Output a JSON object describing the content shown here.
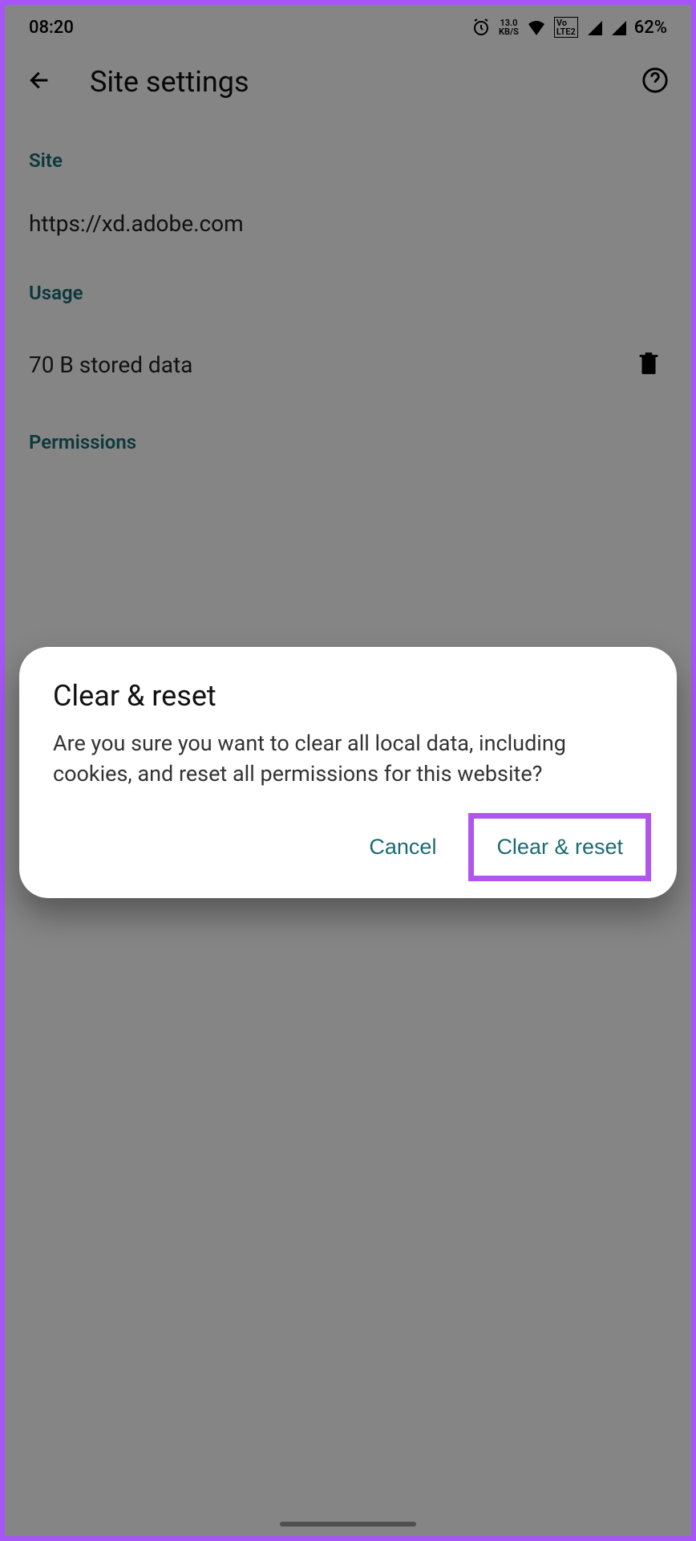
{
  "statusBar": {
    "time": "08:20",
    "dataRate": "13.0",
    "dataUnit": "KB/S",
    "volte": "Vo LTE 2",
    "battery": "62%"
  },
  "header": {
    "title": "Site settings"
  },
  "sections": {
    "site": {
      "label": "Site",
      "url": "https://xd.adobe.com"
    },
    "usage": {
      "label": "Usage",
      "stored": "70 B stored data"
    },
    "permissions": {
      "label": "Permissions"
    }
  },
  "dialog": {
    "title": "Clear & reset",
    "body": "Are you sure you want to clear all local data, including cookies, and reset all permissions for this website?",
    "cancel": "Cancel",
    "confirm": "Clear & reset"
  }
}
